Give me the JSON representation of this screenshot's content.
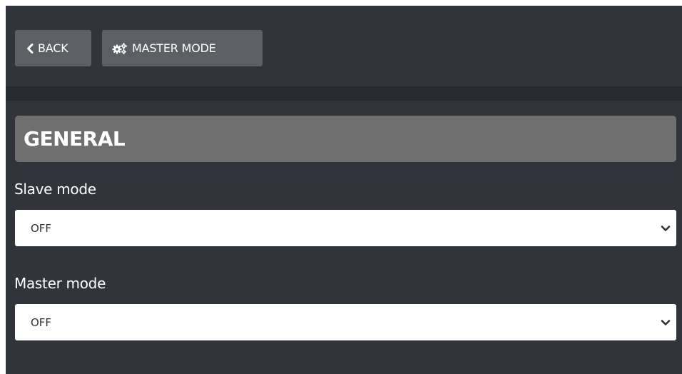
{
  "toolbar": {
    "back_label": "BACK",
    "back_icon": "chevron-left-icon",
    "master_mode_label": "MASTER MODE",
    "master_mode_icon": "cogs-icon"
  },
  "section": {
    "title": "GENERAL"
  },
  "fields": {
    "slave_mode": {
      "label": "Slave mode",
      "value": "OFF"
    },
    "master_mode": {
      "label": "Master mode",
      "value": "OFF"
    }
  },
  "colors": {
    "background": "#31343b",
    "divider": "#272a30",
    "button": "#5c5f64",
    "section_header": "#6f6f6f",
    "text": "#ffffff"
  }
}
